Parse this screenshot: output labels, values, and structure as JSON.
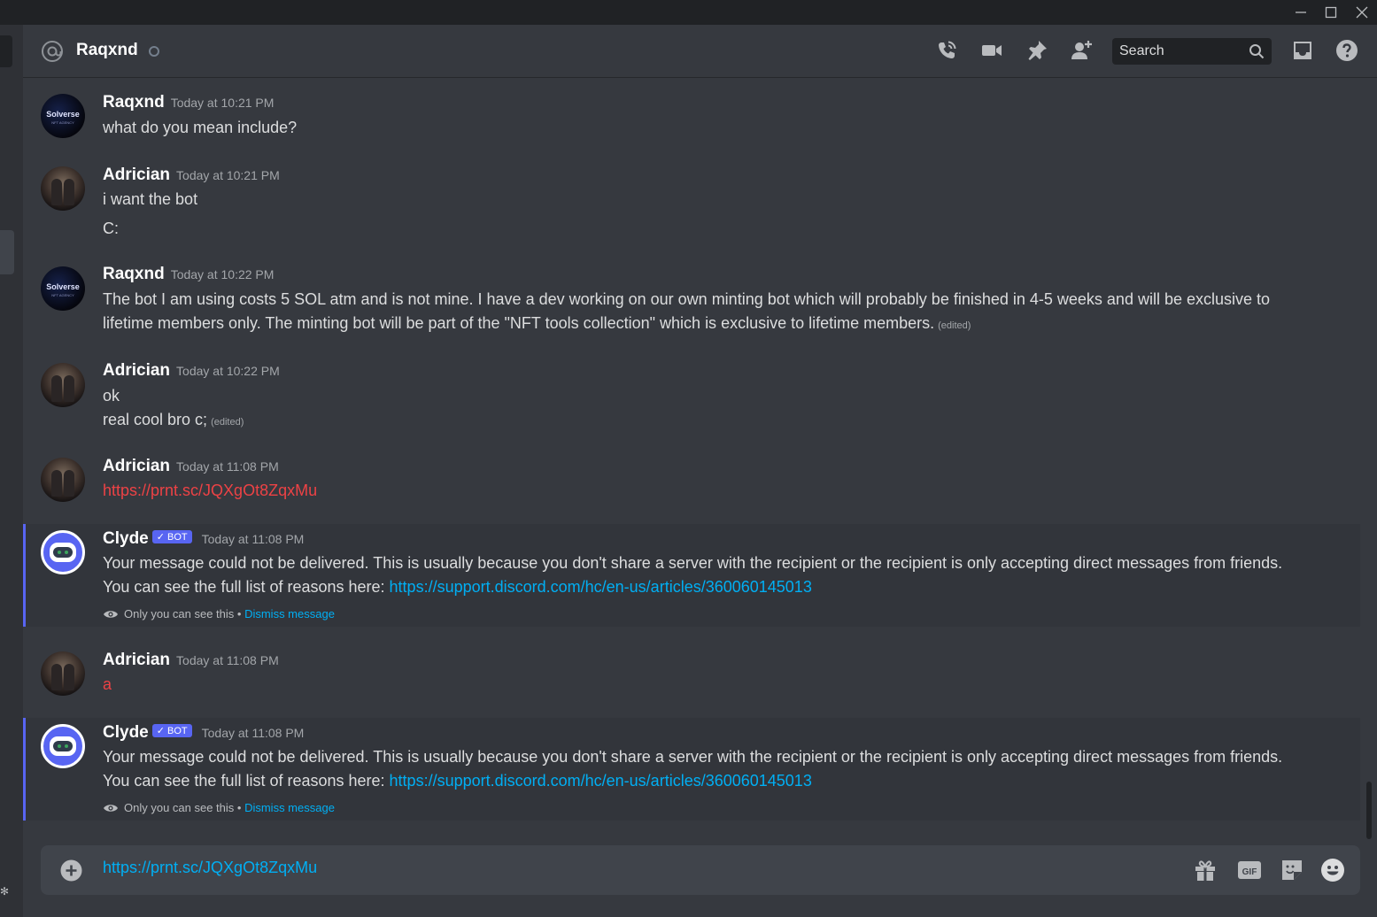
{
  "header": {
    "channel": "Raqxnd",
    "search_placeholder": "Search"
  },
  "messages": [
    {
      "avatar": "solverse",
      "avatar_text": "Solverse",
      "avatar_subtext": "NFT AGENCY",
      "author": "Raqxnd",
      "time": "Today at 10:21 PM",
      "lines": [
        "what do you mean include?"
      ]
    },
    {
      "avatar": "adrician",
      "author": "Adrician",
      "time": "Today at 10:21 PM",
      "lines": [
        "i want the bot",
        "C:"
      ]
    },
    {
      "avatar": "solverse",
      "avatar_text": "Solverse",
      "avatar_subtext": "NFT AGENCY",
      "author": "Raqxnd",
      "time": "Today at 10:22 PM",
      "text": "The bot I am using costs 5 SOL atm and is not mine. I have a dev working on our own minting bot which will probably be finished in 4-5 weeks and will be exclusive to lifetime members only. The minting bot will be part of the \"NFT tools collection\" which is exclusive to lifetime members.",
      "edited": "(edited)"
    },
    {
      "avatar": "adrician",
      "author": "Adrician",
      "time": "Today at 10:22 PM",
      "lines": [
        "ok",
        "real cool bro c;"
      ],
      "edited": "(edited)"
    },
    {
      "avatar": "adrician",
      "author": "Adrician",
      "time": "Today at 11:08 PM",
      "text": "https://prnt.sc/JQXgOt8ZqxMu"
    },
    {
      "avatar": "clyde",
      "author": "Clyde",
      "bot_tag": "✓ BOT",
      "time": "Today at 11:08 PM",
      "text": "Your message could not be delivered. This is usually because you don't share a server with the recipient or the recipient is only accepting direct messages from friends. You can see the full list of reasons here: ",
      "link": "https://support.discord.com/hc/en-us/articles/360060145013",
      "only_you": "Only you can see this •",
      "dismiss": "Dismiss message"
    },
    {
      "avatar": "adrician",
      "author": "Adrician",
      "time": "Today at 11:08 PM",
      "text": "a"
    },
    {
      "avatar": "clyde",
      "author": "Clyde",
      "bot_tag": "✓ BOT",
      "time": "Today at 11:08 PM",
      "text": "Your message could not be delivered. This is usually because you don't share a server with the recipient or the recipient is only accepting direct messages from friends. You can see the full list of reasons here: ",
      "link": "https://support.discord.com/hc/en-us/articles/360060145013",
      "only_you": "Only you can see this •",
      "dismiss": "Dismiss message"
    }
  ],
  "composer": {
    "value": "https://prnt.sc/JQXgOt8ZqxMu"
  },
  "icons": {
    "header": [
      "at-icon",
      "call-icon",
      "video-icon",
      "pin-icon",
      "add-friend-icon",
      "search-icon",
      "inbox-icon",
      "help-icon"
    ],
    "composer": [
      "plus-icon",
      "gift-icon",
      "gif-icon",
      "sticker-icon",
      "emoji-icon"
    ],
    "window": [
      "minimize-icon",
      "maximize-icon",
      "close-icon"
    ]
  },
  "colors": {
    "background": "#36393f",
    "accent": "#5865f2",
    "link": "#00aff4",
    "error_text": "#ed4245",
    "system_bg": "#32353b"
  }
}
